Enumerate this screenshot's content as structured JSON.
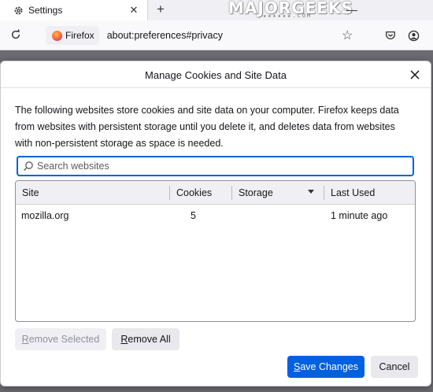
{
  "browser": {
    "tab": {
      "title": "Settings"
    },
    "watermark": {
      "text": "MAJORGEEKS",
      "sub": "★★★★★★.COM"
    },
    "identity_label": "Firefox",
    "url": "about:preferences#privacy"
  },
  "dialog": {
    "title": "Manage Cookies and Site Data",
    "description": "The following websites store cookies and site data on your computer. Firefox keeps data from websites with persistent storage until you delete it, and deletes data from websites with non-persistent storage as space is needed.",
    "search_placeholder": "Search websites",
    "columns": [
      "Site",
      "Cookies",
      "Storage",
      "Last Used"
    ],
    "rows": [
      {
        "site": "mozilla.org",
        "cookies": "5",
        "storage": "",
        "last_used": "1 minute ago"
      }
    ],
    "buttons": {
      "remove_selected": {
        "first": "R",
        "rest": "emove Selected"
      },
      "remove_all": {
        "first": "R",
        "rest": "emove All"
      },
      "save_changes": {
        "first": "S",
        "rest": "ave Changes"
      },
      "cancel": "Cancel"
    }
  },
  "colors": {
    "accent": "#0061e0",
    "dialog_bg": "#ffffff",
    "header_bg": "#f0f0f4"
  }
}
